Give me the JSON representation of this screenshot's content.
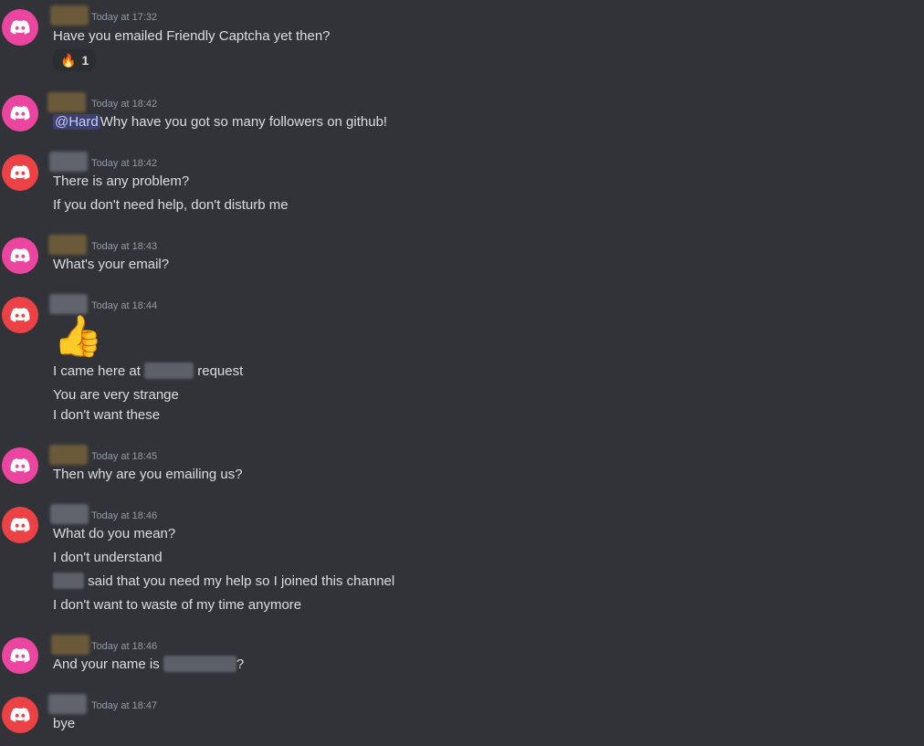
{
  "messages": [
    {
      "avatar_color": "pink",
      "name_color": "gold",
      "timestamp": "Today at 17:32",
      "lines": [
        "Have you emailed Friendly Captcha yet then?"
      ],
      "reaction": {
        "emoji": "🔥",
        "count": "1"
      }
    },
    {
      "avatar_color": "pink",
      "name_color": "gold",
      "timestamp": "Today at 18:42",
      "mention": "@Hard",
      "lines": [
        "Why have you got so many followers on github!"
      ]
    },
    {
      "avatar_color": "red",
      "name_color": "gray",
      "timestamp": "Today at 18:42",
      "lines": [
        "There is any problem?",
        "If you don't need help, don't disturb me"
      ]
    },
    {
      "avatar_color": "pink",
      "name_color": "gold",
      "timestamp": "Today at 18:43",
      "lines": [
        "What's your email?"
      ]
    },
    {
      "avatar_color": "red",
      "name_color": "gray",
      "timestamp": "Today at 18:44",
      "big_emoji": "👍",
      "lines": [
        {
          "before": "I came here at ",
          "after": " request"
        },
        "You are very strange",
        "I don't want these"
      ]
    },
    {
      "avatar_color": "pink",
      "name_color": "gold",
      "timestamp": "Today at 18:45",
      "lines": [
        "Then why are you emailing us?"
      ]
    },
    {
      "avatar_color": "red",
      "name_color": "gray",
      "timestamp": "Today at 18:46",
      "lines": [
        "What do you mean?",
        "I don't understand",
        {
          "before": "",
          "after": " said that you need my help so I joined this channel"
        },
        "I don't want to waste of my time anymore"
      ]
    },
    {
      "avatar_color": "pink",
      "name_color": "gold",
      "timestamp": "Today at 18:46",
      "lines": [
        {
          "before": "And your name is ",
          "after": "?"
        }
      ]
    },
    {
      "avatar_color": "red",
      "name_color": "gray",
      "timestamp": "Today at 18:47",
      "lines": [
        "bye"
      ]
    }
  ],
  "colors": {
    "background": "#313338",
    "text": "#dbdee1",
    "timestamp": "#949ba4",
    "pink_avatar": "#eb459f",
    "red_avatar": "#ed4245"
  }
}
